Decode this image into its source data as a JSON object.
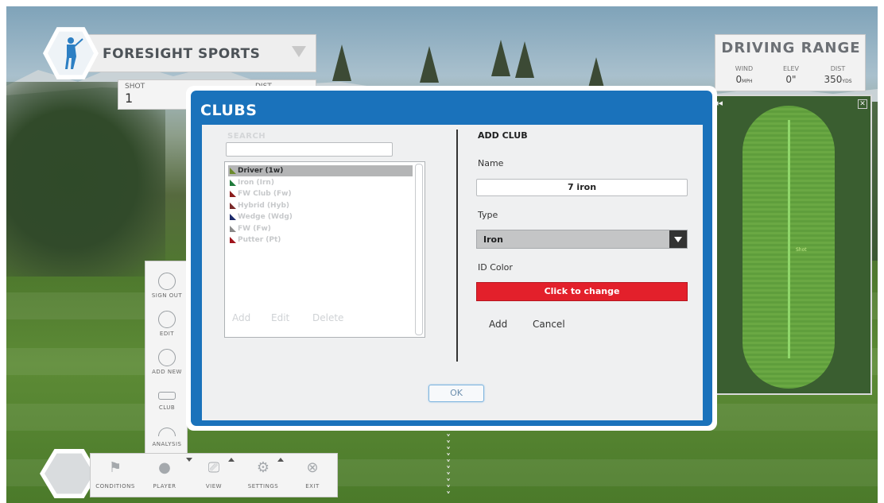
{
  "brand": {
    "name": "FORESIGHT SPORTS"
  },
  "shot": {
    "shot_label": "SHOT",
    "shot_value": "1",
    "dist_label": "DIST"
  },
  "range": {
    "title": "DRIVING RANGE",
    "wind_label": "WIND",
    "wind_value": "0",
    "wind_unit": "MPH",
    "elev_label": "ELEV",
    "elev_value": "0\"",
    "dist_label": "DIST",
    "dist_value": "350",
    "dist_unit": "YDS"
  },
  "minimap": {
    "rewind_glyph": "◂◂",
    "close_glyph": "✕",
    "shot_label": "Shot"
  },
  "sidemenu": {
    "items": [
      {
        "label": "SIGN OUT",
        "icon": "golfer-icon"
      },
      {
        "label": "EDIT",
        "icon": "golfer-icon"
      },
      {
        "label": "ADD NEW",
        "icon": "golfer-icon"
      },
      {
        "label": "CLUB",
        "icon": "club-icon"
      },
      {
        "label": "ANALYSIS",
        "icon": "analysis-icon"
      }
    ]
  },
  "bottombar": {
    "items": [
      {
        "label": "CONDITIONS",
        "icon": "flag-icon",
        "glyph": "⚑"
      },
      {
        "label": "PLAYER",
        "icon": "player-icon",
        "glyph": "●"
      },
      {
        "label": "VIEW",
        "icon": "camera-icon",
        "glyph": "⎚"
      },
      {
        "label": "SETTINGS",
        "icon": "gear-icon",
        "glyph": "⚙"
      },
      {
        "label": "EXIT",
        "icon": "exit-icon",
        "glyph": "⊗"
      }
    ]
  },
  "dialog": {
    "title": "CLUBS",
    "search_label": "SEARCH",
    "search_value": "",
    "clubs": [
      {
        "label": "Driver  (1w)",
        "color": "#6c8a2c",
        "selected": true
      },
      {
        "label": "Iron  (Irn)",
        "color": "#1f7a3b",
        "selected": false
      },
      {
        "label": "FW Club  (Fw)",
        "color": "#8b1c1c",
        "selected": false
      },
      {
        "label": "Hybrid  (Hyb)",
        "color": "#7a2a2a",
        "selected": false
      },
      {
        "label": "Wedge  (Wdg)",
        "color": "#1c2a6b",
        "selected": false
      },
      {
        "label": "FW  (Fw)",
        "color": "#8a8a8a",
        "selected": false
      },
      {
        "label": "Putter  (Pt)",
        "color": "#a0141c",
        "selected": false
      }
    ],
    "list_actions": {
      "add": "Add",
      "edit": "Edit",
      "delete": "Delete"
    },
    "form": {
      "title": "ADD CLUB",
      "name_label": "Name",
      "name_value": "7 iron",
      "type_label": "Type",
      "type_value": "Iron",
      "color_label": "ID Color",
      "color_button": "Click to change",
      "color_value": "#e3202b",
      "add": "Add",
      "cancel": "Cancel"
    },
    "ok": "OK"
  }
}
